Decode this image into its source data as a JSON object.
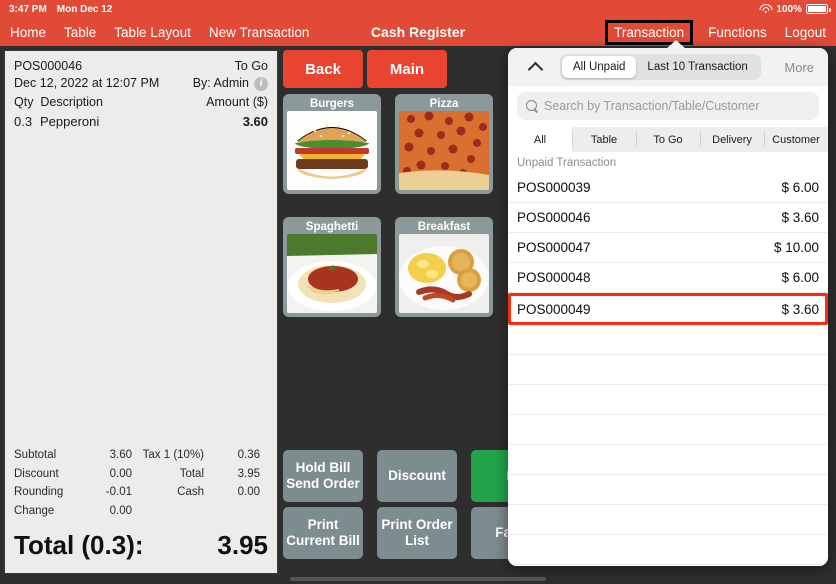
{
  "statusbar": {
    "time": "3:47 PM",
    "date": "Mon Dec 12",
    "battery_pct": "100%",
    "wifi_icon": "wifi-icon",
    "battery_icon": "battery-icon"
  },
  "nav": {
    "title": "Cash Register",
    "left_items": [
      {
        "label": "Home",
        "name": "nav-home"
      },
      {
        "label": "Table",
        "name": "nav-table"
      },
      {
        "label": "Table Layout",
        "name": "nav-table-layout"
      },
      {
        "label": "New Transaction",
        "name": "nav-new-transaction"
      }
    ],
    "right_items": [
      {
        "label": "Transaction",
        "name": "nav-transaction"
      },
      {
        "label": "Functions",
        "name": "nav-functions"
      },
      {
        "label": "Logout",
        "name": "nav-logout"
      }
    ]
  },
  "receipt": {
    "order_no": "POS000046",
    "order_type": "To Go",
    "datetime": "Dec 12, 2022 at 12:07 PM",
    "by": "By: Admin",
    "info_icon": "info-icon",
    "col_qty": "Qty",
    "col_desc": "Description",
    "col_amount": "Amount ($)",
    "lines": [
      {
        "qty": "0.3",
        "desc": "Pepperoni",
        "amount": "3.60"
      }
    ],
    "totals": [
      {
        "l1": "Subtotal",
        "v1": "3.60",
        "l2": "Tax 1 (10%)",
        "v2": "0.36"
      },
      {
        "l1": "Discount",
        "v1": "0.00",
        "l2": "Total",
        "v2": "3.95"
      },
      {
        "l1": "Rounding",
        "v1": "-0.01",
        "l2": "Cash",
        "v2": "0.00"
      },
      {
        "l1": "Change",
        "v1": "0.00",
        "l2": "",
        "v2": ""
      }
    ],
    "grand_label": "Total (0.3):",
    "grand_value": "3.95"
  },
  "middle": {
    "top_buttons": [
      {
        "label": "Back",
        "name": "back-button"
      },
      {
        "label": "Main",
        "name": "main-button"
      }
    ],
    "tiles": [
      {
        "label": "Burgers",
        "name": "category-tile-burgers"
      },
      {
        "label": "Pizza",
        "name": "category-tile-pizza"
      },
      {
        "label": "Spaghetti",
        "name": "category-tile-spaghetti"
      },
      {
        "label": "Breakfast",
        "name": "category-tile-breakfast"
      }
    ],
    "actions": [
      {
        "label": "Hold Bill\nSend Order",
        "name": "hold-bill-send-order-button",
        "style": "gray"
      },
      {
        "label": "Discount",
        "name": "discount-button",
        "style": "gray"
      },
      {
        "label": "P",
        "name": "pay-button",
        "style": "green"
      },
      {
        "label": "Print\nCurrent Bill",
        "name": "print-current-bill-button",
        "style": "gray"
      },
      {
        "label": "Print Order\nList",
        "name": "print-order-list-button",
        "style": "gray"
      },
      {
        "label": "Favo",
        "name": "favorite-button",
        "style": "gray"
      }
    ],
    "search_icon": "search-icon"
  },
  "popup": {
    "collapse_icon": "chevron-up-icon",
    "segments": [
      {
        "label": "All Unpaid",
        "selected": true
      },
      {
        "label": "Last 10 Transaction",
        "selected": false
      }
    ],
    "more_label": "More",
    "search_placeholder": "Search by Transaction/Table/Customer",
    "search_icon": "search-icon",
    "filters": [
      {
        "label": "All",
        "selected": true
      },
      {
        "label": "Table",
        "selected": false
      },
      {
        "label": "To Go",
        "selected": false
      },
      {
        "label": "Delivery",
        "selected": false
      },
      {
        "label": "Customer",
        "selected": false
      }
    ],
    "section_label": "Unpaid Transaction",
    "transactions": [
      {
        "id": "POS000039",
        "amount": "$ 6.00",
        "selected": false
      },
      {
        "id": "POS000046",
        "amount": "$ 3.60",
        "selected": false
      },
      {
        "id": "POS000047",
        "amount": "$ 10.00",
        "selected": false
      },
      {
        "id": "POS000048",
        "amount": "$ 6.00",
        "selected": false
      },
      {
        "id": "POS000049",
        "amount": "$ 3.60",
        "selected": true
      }
    ],
    "empty_row_count": 8
  },
  "colors": {
    "brand_red": "#e24a38",
    "button_red": "#e8442f",
    "pay_green": "#23a349",
    "gray_button": "#7d8c8e",
    "highlight_red": "#ff2a12"
  }
}
